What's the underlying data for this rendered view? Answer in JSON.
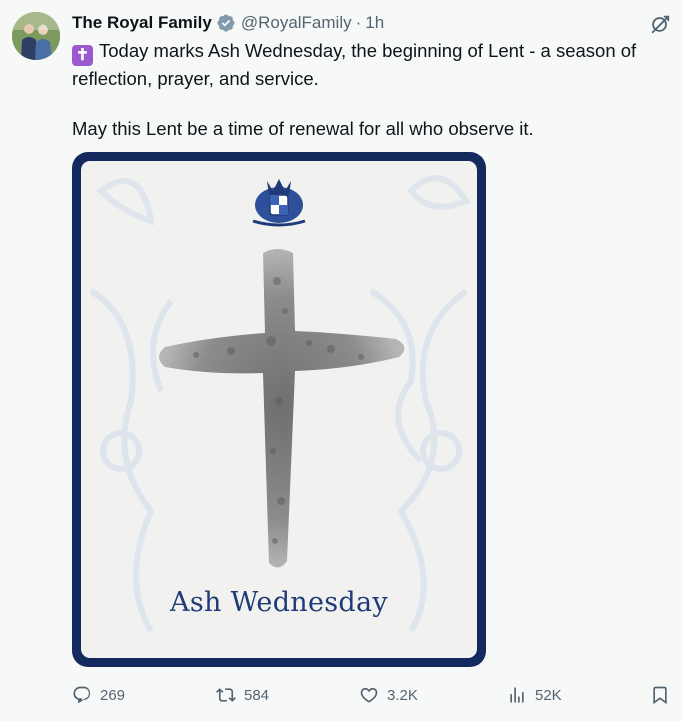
{
  "tweet": {
    "display_name": "The Royal Family",
    "handle": "@RoyalFamily",
    "separator": "·",
    "time": "1h",
    "body_line1": "Today marks Ash Wednesday, the beginning of Lent - a season of reflection, prayer, and service.",
    "body_line2": "May this Lent be a time of renewal for all who observe it.",
    "emoji": "✝"
  },
  "media": {
    "caption": "Ash Wednesday",
    "colors": {
      "frame": "#142a5e",
      "card": "#f1f1ef",
      "caption": "#1f3a78"
    }
  },
  "actions": {
    "replies": "269",
    "reposts": "584",
    "likes": "3.2K",
    "views": "52K"
  },
  "icons": [
    "avatar",
    "verified-icon",
    "grok-icon",
    "reply-icon",
    "repost-icon",
    "like-icon",
    "views-icon",
    "bookmark-icon"
  ]
}
